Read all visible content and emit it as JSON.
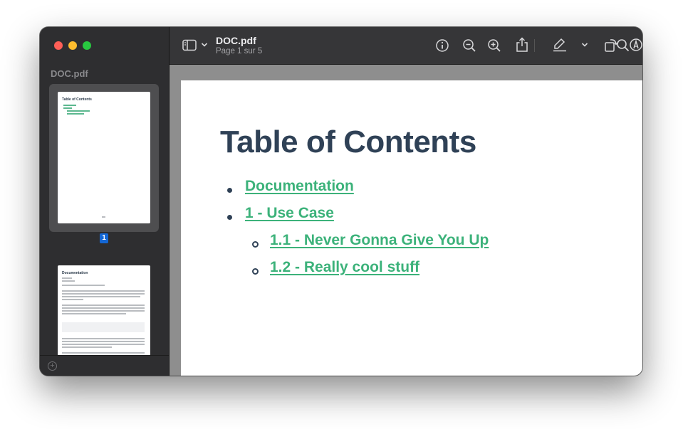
{
  "sidebar": {
    "title": "DOC.pdf",
    "selected_page_number": "1",
    "thumbnails": [
      {
        "title": "Table of Contents"
      },
      {
        "title": "Documentation"
      }
    ]
  },
  "toolbar": {
    "doc_name": "DOC.pdf",
    "page_status": "Page 1 sur 5",
    "icons": [
      "sidebar-toggle-icon",
      "chevron-down-icon",
      "info-icon",
      "zoom-out-icon",
      "zoom-in-icon",
      "share-icon",
      "highlight-pen-icon",
      "chevron-down-icon",
      "rotate-icon",
      "markup-icon",
      "search-icon"
    ]
  },
  "page": {
    "title": "Table of Contents",
    "toc": [
      {
        "label": "Documentation",
        "level": 1
      },
      {
        "label": "1 - Use Case",
        "level": 1
      },
      {
        "label": "1.1 - Never Gonna Give You Up",
        "level": 2
      },
      {
        "label": "1.2 - Really cool stuff",
        "level": 2
      }
    ]
  },
  "colors": {
    "link": "#3cb27a",
    "heading": "#2f4156",
    "selection": "#1467d4"
  }
}
